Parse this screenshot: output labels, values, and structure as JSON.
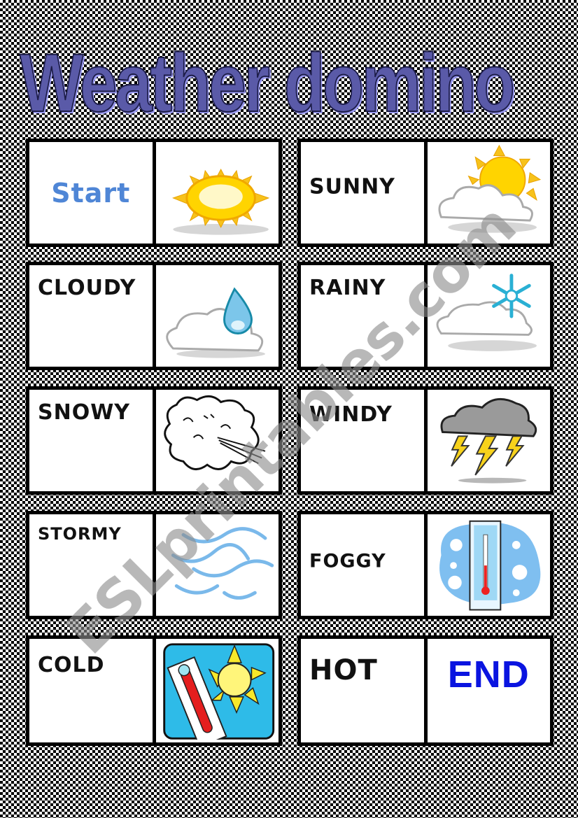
{
  "title": "Weather domino",
  "watermark": "ESLprintables.com",
  "colors": {
    "title_fill": "#5a5aa8",
    "start_text": "#4f86d6",
    "end_text": "#0a14e0"
  },
  "cards": [
    {
      "word": "Start",
      "picture": "sun-icon"
    },
    {
      "word": "SUNNY",
      "picture": "sun-behind-cloud-icon"
    },
    {
      "word": "CLOUDY",
      "picture": "cloud-with-raindrop-icon"
    },
    {
      "word": "RAINY",
      "picture": "cloud-with-snowflake-icon"
    },
    {
      "word": "SNOWY",
      "picture": "wind-blowing-cloud-face-icon"
    },
    {
      "word": "WINDY",
      "picture": "thundercloud-lightning-icon"
    },
    {
      "word": "STORMY",
      "picture": "fog-wind-waves-icon"
    },
    {
      "word": "FOGGY",
      "picture": "cold-thermometer-snowflakes-icon"
    },
    {
      "word": "COLD",
      "picture": "hot-thermometer-sun-icon"
    },
    {
      "word": "HOT",
      "picture_text": "END"
    }
  ]
}
